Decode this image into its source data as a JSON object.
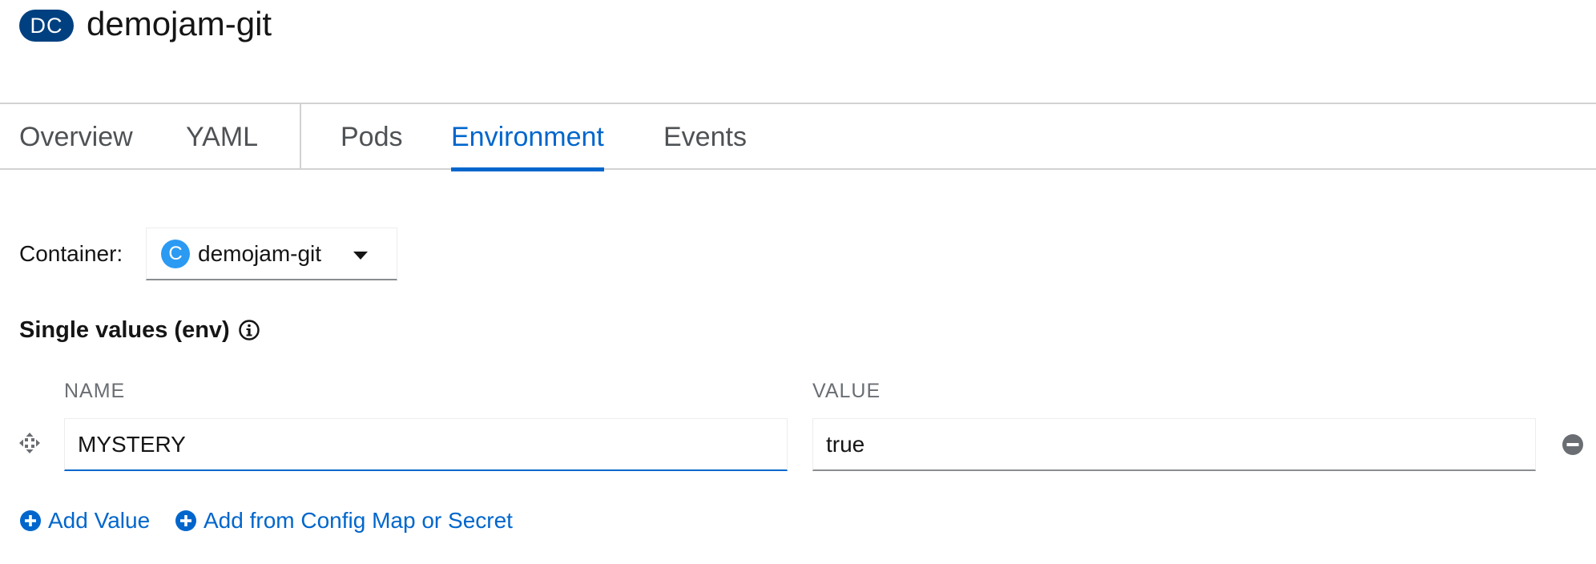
{
  "header": {
    "kind_badge": "DC",
    "title": "demojam-git"
  },
  "tabs": [
    {
      "label": "Overview",
      "active": false
    },
    {
      "label": "YAML",
      "active": false
    },
    {
      "label": "Pods",
      "active": false
    },
    {
      "label": "Environment",
      "active": true
    },
    {
      "label": "Events",
      "active": false
    }
  ],
  "container": {
    "label": "Container:",
    "badge": "C",
    "selected": "demojam-git"
  },
  "env": {
    "section_title": "Single values (env)",
    "columns": {
      "name": "NAME",
      "value": "VALUE"
    },
    "rows": [
      {
        "name": "MYSTERY",
        "value": "true"
      }
    ],
    "add_value_label": "Add Value",
    "add_from_label": "Add from Config Map or Secret"
  },
  "colors": {
    "accent": "#0066cc",
    "badge_dc": "#004080",
    "badge_c": "#2b9af3"
  },
  "icons": {
    "info": "info-circle-icon",
    "drag": "drag-handle-icon",
    "remove": "minus-circle-icon",
    "add": "plus-circle-icon",
    "caret": "caret-down-icon"
  }
}
